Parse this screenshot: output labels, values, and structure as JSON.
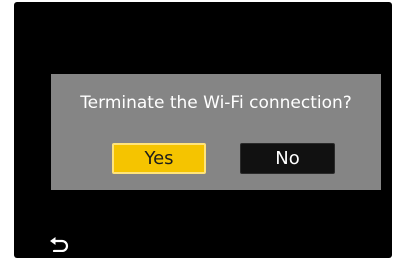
{
  "dialog": {
    "message": "Terminate the Wi-Fi connection?",
    "buttons": {
      "yes_label": "Yes",
      "no_label": "No"
    },
    "selected": "Yes"
  },
  "footer": {
    "back_icon": "back-arrow-icon"
  },
  "colors": {
    "screen_background": "#000000",
    "dialog_background": "#858585",
    "selected_button": "#f5c400",
    "unselected_button": "#111111",
    "text_light": "#ffffff"
  }
}
